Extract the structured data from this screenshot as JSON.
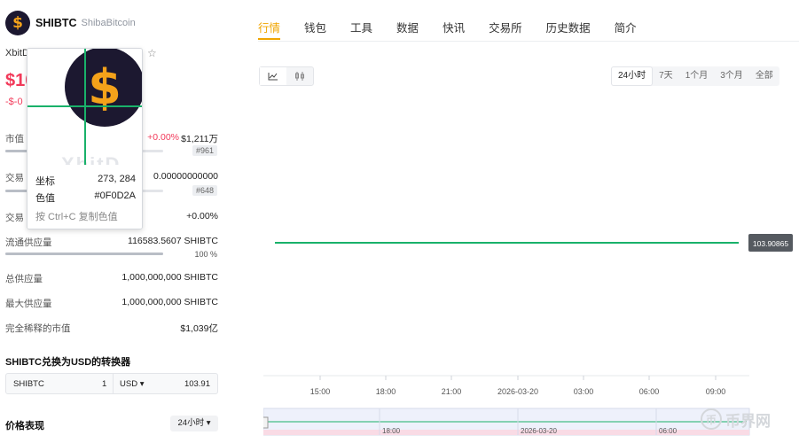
{
  "coin": {
    "symbol": "SHIBTC",
    "name": "ShibaBitcoin",
    "exchange": "XbitD",
    "logo_glyph": "$",
    "price": "$10",
    "change": "-$-0",
    "logo_color": "#1c1830",
    "accent_color": "#f4a21a"
  },
  "stats": {
    "market_cap": {
      "label": "市值",
      "pct": "+0.00%",
      "value": "$1,211万",
      "rank": "#961"
    },
    "volume": {
      "label": "交易",
      "value": "0.00000000000",
      "rank": "#648"
    },
    "volume_change": {
      "label": "交易",
      "value": "+0.00%"
    },
    "circulating": {
      "label": "流通供应量",
      "value": "116583.5607 SHIBTC",
      "pct_label": "100 %",
      "fill": 100
    },
    "total_supply": {
      "label": "总供应量",
      "value": "1,000,000,000 SHIBTC"
    },
    "max_supply": {
      "label": "最大供应量",
      "value": "1,000,000,000 SHIBTC"
    },
    "fdv": {
      "label": "完全稀释的市值",
      "value": "$1,039亿"
    }
  },
  "converter": {
    "title": "SHIBTC兑换为USD的转换器",
    "from_symbol": "SHIBTC",
    "from_amount": "1",
    "to_symbol": "USD",
    "to_amount": "103.91"
  },
  "performance": {
    "title": "价格表现",
    "period": "24小时"
  },
  "magnifier": {
    "coord_label": "坐标",
    "coord_value": "273, 284",
    "color_label": "色值",
    "color_value": "#0F0D2A",
    "hint": "按 Ctrl+C 复制色值",
    "ghost_text": "XbitD"
  },
  "tabs": [
    "行情",
    "钱包",
    "工具",
    "数据",
    "快讯",
    "交易所",
    "历史数据",
    "简介"
  ],
  "chart_types": [
    "line-chart-icon",
    "candlestick-icon"
  ],
  "ranges": [
    "24小时",
    "7天",
    "1个月",
    "3个月",
    "全部"
  ],
  "watermark": {
    "glyph": "币",
    "text": "币界网"
  },
  "chart_data": {
    "type": "line",
    "x": [
      "2026-03-19 12:00",
      "2026-03-20 10:30"
    ],
    "y": [
      103.90865,
      103.90865
    ],
    "price_label": "103.90865",
    "xticks": [
      "15:00",
      "18:00",
      "21:00",
      "2026-03-20",
      "03:00",
      "06:00",
      "09:00"
    ],
    "navigator_ticks": [
      "18:00",
      "2026-03-20",
      "06:00"
    ],
    "line_color": "#19b16a",
    "grid": false
  }
}
